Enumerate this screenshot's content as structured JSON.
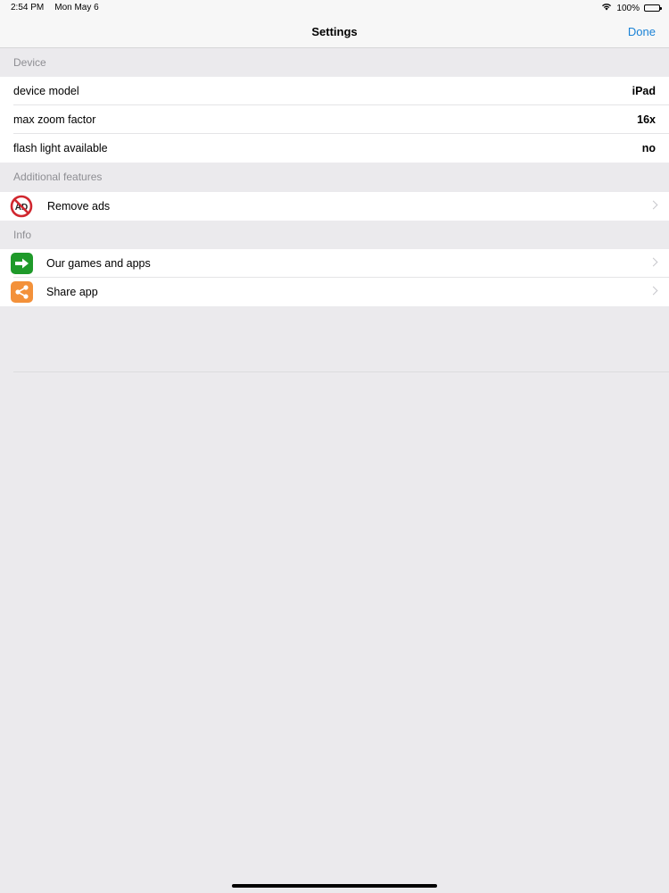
{
  "status_bar": {
    "time": "2:54 PM",
    "date": "Mon May 6",
    "battery": "100%"
  },
  "nav": {
    "title": "Settings",
    "done_label": "Done"
  },
  "sections": {
    "device": {
      "header": "Device",
      "rows": [
        {
          "label": "device model",
          "value": "iPad"
        },
        {
          "label": "max zoom factor",
          "value": "16x"
        },
        {
          "label": "flash light available",
          "value": "no"
        }
      ]
    },
    "additional": {
      "header": "Additional features",
      "rows": [
        {
          "label": "Remove ads",
          "icon": "no-ads-icon",
          "icon_text": "AD"
        }
      ]
    },
    "info": {
      "header": "Info",
      "rows": [
        {
          "label": "Our games and apps",
          "icon": "arrow-right-icon"
        },
        {
          "label": "Share app",
          "icon": "share-icon"
        }
      ]
    }
  },
  "colors": {
    "accent": "#1a82d6",
    "background": "#ebeaed",
    "green_icon": "#1f9a2a",
    "orange_icon": "#f3913a",
    "no_ads_red": "#d0262e"
  }
}
